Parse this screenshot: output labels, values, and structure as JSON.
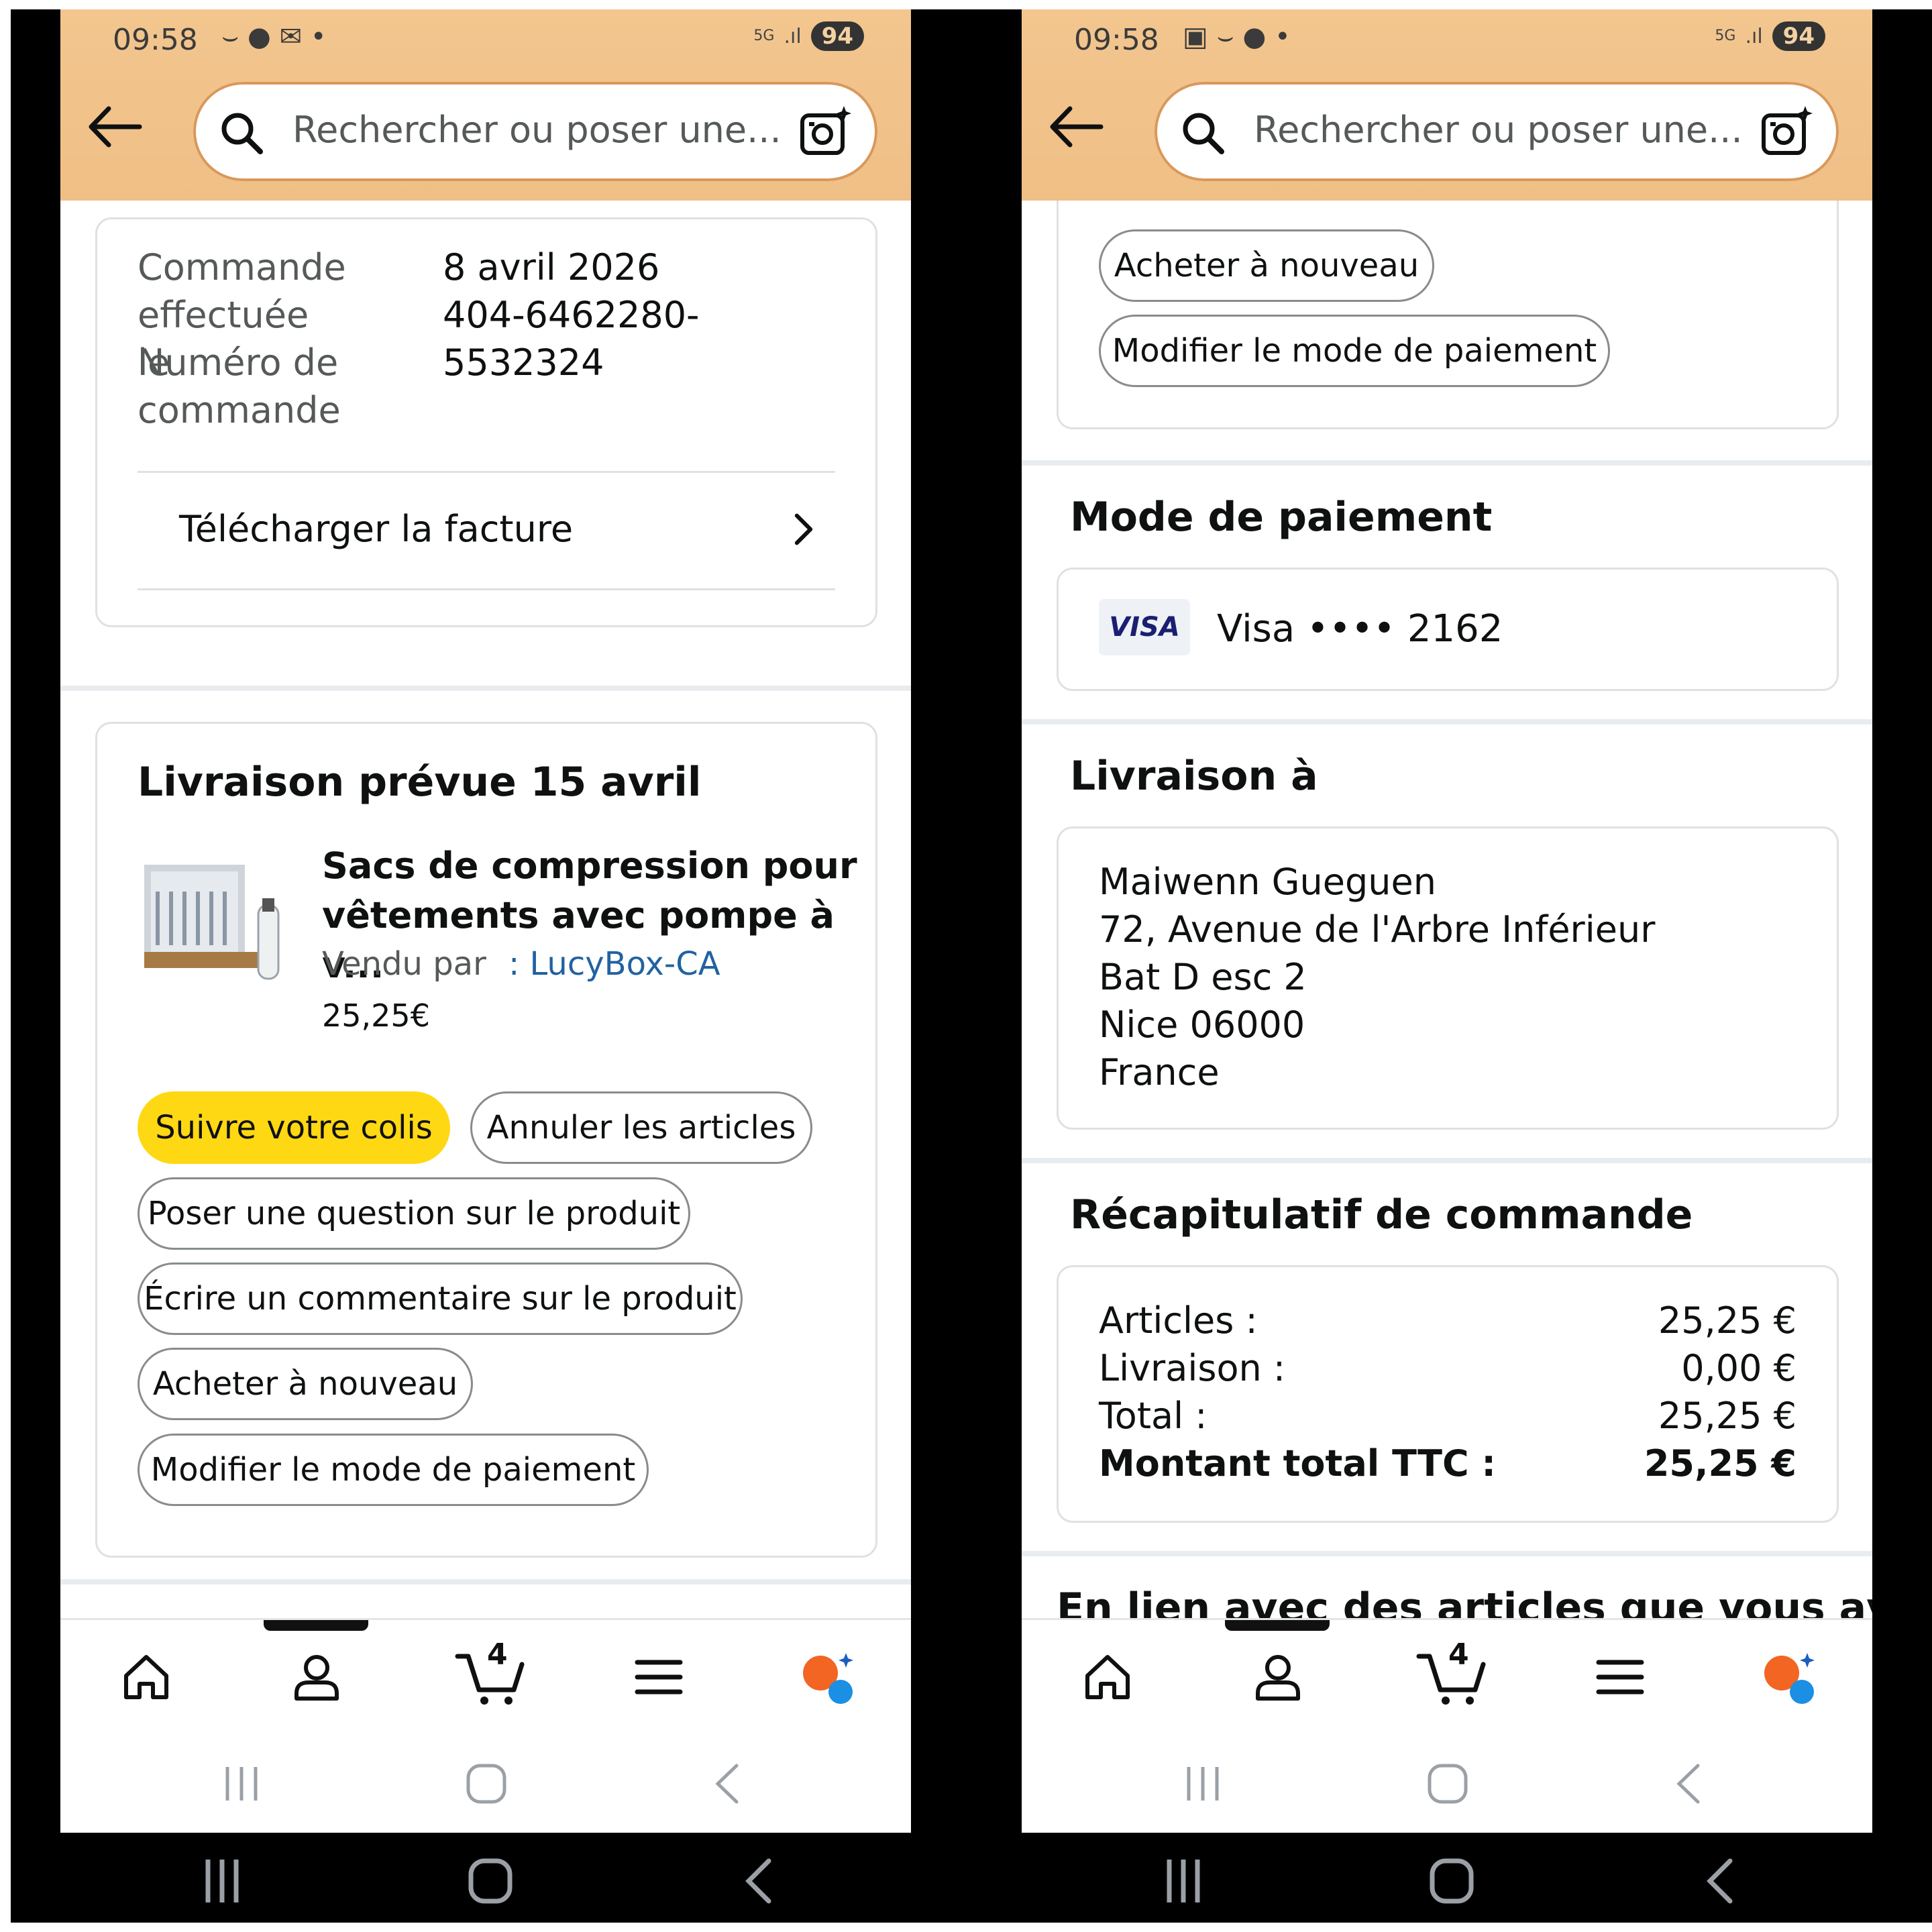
{
  "status": {
    "time": "09:58",
    "network": "5G",
    "battery": "94"
  },
  "search": {
    "placeholder": "Rechercher ou poser une..."
  },
  "left": {
    "order": {
      "date_label": "Commande effectuée le",
      "date_value": "8 avril 2026",
      "number_label": "Numéro de commande",
      "number_value_line1": "404-6462280-",
      "number_value_line2": "5532324",
      "invoice_label": "Télécharger la facture"
    },
    "delivery": {
      "title": "Livraison prévue 15 avril",
      "product_title_line1": "Sacs de compression pour",
      "product_title_line2": "vêtements avec pompe à v...",
      "sold_by_label": "Vendu par",
      "seller": ": LucyBox-CA",
      "price": "25,25€"
    },
    "buttons": {
      "track": "Suivre votre colis",
      "cancel": "Annuler les articles",
      "question": "Poser une question sur le produit",
      "review": "Écrire un commentaire sur le produit",
      "buy_again": "Acheter à nouveau",
      "change_payment": "Modifier le mode de paiement"
    }
  },
  "right": {
    "buttons": {
      "buy_again": "Acheter à nouveau",
      "change_payment": "Modifier le mode de paiement"
    },
    "payment": {
      "title": "Mode de paiement",
      "card_brand": "VISA",
      "card_text": "Visa •••• 2162"
    },
    "shipping": {
      "title": "Livraison à",
      "name": "Maiwenn Gueguen",
      "address1": "72, Avenue de l'Arbre Inférieur",
      "address2": "Bat D esc 2",
      "city": "Nice 06000",
      "country": "France"
    },
    "summary": {
      "title": "Récapitulatif de commande",
      "items_label": "Articles :",
      "items_value": "25,25 €",
      "shipping_label": "Livraison :",
      "shipping_value": "0,00 €",
      "total_label": "Total :",
      "total_value": "25,25 €",
      "grand_label": "Montant total TTC :",
      "grand_value": "25,25 €"
    },
    "related": "En lien avec des articles que vous avez"
  },
  "nav": {
    "cart_count": "4"
  },
  "colors": {
    "header": "#f0c088",
    "track_button": "#ffd814",
    "link": "#2162a1",
    "visa": "#1a1f71"
  }
}
